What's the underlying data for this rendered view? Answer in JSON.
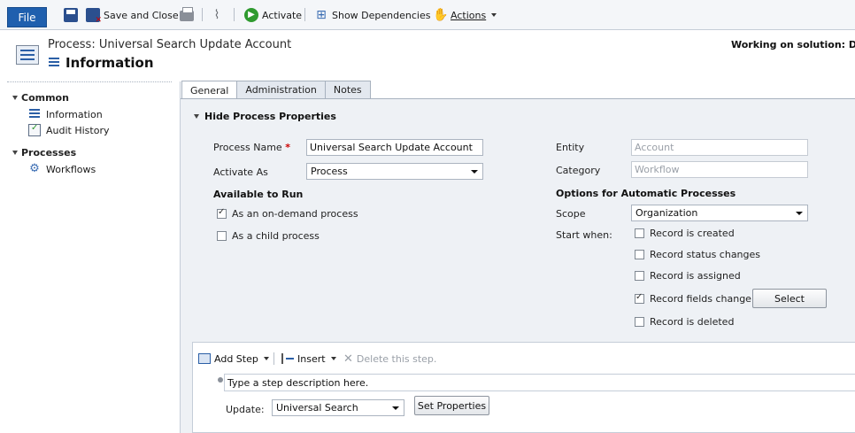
{
  "ribbon": {
    "file_label": "File",
    "save_and_close": "Save and Close",
    "activate": "Activate",
    "show_dependencies": "Show Dependencies",
    "actions": "Actions"
  },
  "header": {
    "process_title": "Process: Universal Search Update Account",
    "form_title": "Information",
    "solution_text": "Working on solution: Default Solution"
  },
  "nav": {
    "common_label": "Common",
    "common_items": [
      "Information",
      "Audit History"
    ],
    "processes_label": "Processes",
    "processes_items": [
      "Workflows"
    ]
  },
  "tabs": [
    "General",
    "Administration",
    "Notes"
  ],
  "section": {
    "title": "Hide Process Properties"
  },
  "form": {
    "process_name_label": "Process Name",
    "required_marker": "*",
    "process_name_value": "Universal Search Update Account",
    "activate_as_label": "Activate As",
    "activate_as_value": "Process",
    "available_to_run_label": "Available to Run",
    "on_demand_label": "As an on-demand process",
    "child_process_label": "As a child process",
    "entity_label": "Entity",
    "entity_value": "Account",
    "category_label": "Category",
    "category_value": "Workflow",
    "options_label": "Options for Automatic Processes",
    "scope_label": "Scope",
    "scope_value": "Organization",
    "start_when_label": "Start when:",
    "record_created": "Record is created",
    "record_status": "Record status changes",
    "record_assigned": "Record is assigned",
    "record_fields": "Record fields change",
    "record_deleted": "Record is deleted",
    "select_button": "Select"
  },
  "designer": {
    "add_step": "Add Step",
    "insert": "Insert",
    "delete_step": "Delete this step.",
    "step_description": "Type a step description here.",
    "update_label": "Update:",
    "update_value": "Universal Search",
    "set_properties": "Set Properties"
  }
}
